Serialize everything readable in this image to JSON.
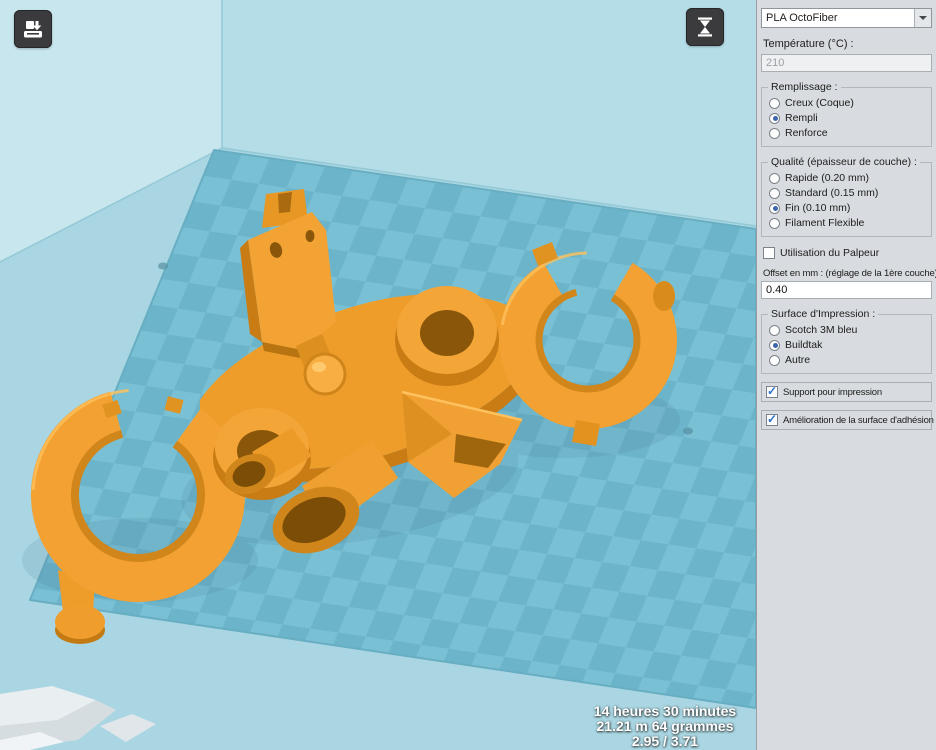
{
  "colors": {
    "model_orange": "#f2a132",
    "model_orange_dark": "#c87c13",
    "plate_check_light": "#7ac0d4",
    "plate_check_dark": "#6cb4c9",
    "floor_blue": "#a9d6e2",
    "wall_blue": "#b4dde8",
    "check_blue": "#2f6fd0"
  },
  "viewport": {
    "toolbar": {
      "save_icon": "printer-export-icon",
      "view_icon": "hourglass-icon"
    },
    "stats": {
      "lines": [
        "14 heures 30 minutes",
        "21.21 m 64 grammes",
        "2.95 / 3.71"
      ]
    }
  },
  "sidebar": {
    "material": {
      "value": "PLA OctoFiber"
    },
    "temperature": {
      "label": "Température (°C) :",
      "value": "210"
    },
    "remplissage": {
      "legend": "Remplissage :",
      "options": [
        {
          "label": "Creux (Coque)",
          "selected": false
        },
        {
          "label": "Rempli",
          "selected": true
        },
        {
          "label": "Renforce",
          "selected": false
        }
      ]
    },
    "qualite": {
      "legend": "Qualité (épaisseur de couche) :",
      "options": [
        {
          "label": "Rapide (0.20 mm)",
          "selected": false
        },
        {
          "label": "Standard (0.15 mm)",
          "selected": false
        },
        {
          "label": "Fin (0.10 mm)",
          "selected": true
        },
        {
          "label": "Filament Flexible",
          "selected": false
        }
      ]
    },
    "palpeur": {
      "label": "Utilisation du Palpeur",
      "checked": false
    },
    "offset": {
      "label": "Offset en mm : (réglage de la 1ère couche)",
      "value": "0.40"
    },
    "surface": {
      "legend": "Surface d'Impression :",
      "options": [
        {
          "label": "Scotch 3M bleu",
          "selected": false
        },
        {
          "label": "Buildtak",
          "selected": true
        },
        {
          "label": "Autre",
          "selected": false
        }
      ]
    },
    "support": {
      "label": "Support pour impression",
      "checked": true
    },
    "adhesion": {
      "label": "Amélioration de la surface d'adhésion",
      "checked": true
    }
  }
}
